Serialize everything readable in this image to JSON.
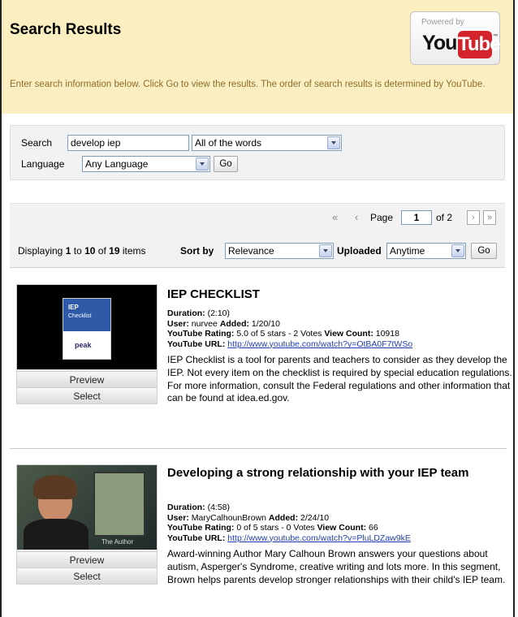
{
  "header": {
    "title": "Search Results",
    "intro": "Enter search information below. Click Go to view the results. The order of search results is determined by YouTube.",
    "badge": {
      "powered_by": "Powered by",
      "you": "You",
      "tube": "Tube",
      "tm": "™"
    }
  },
  "search": {
    "search_label": "Search",
    "query": "develop iep",
    "match_mode": "All of the words",
    "language_label": "Language",
    "language": "Any Language",
    "go_label": "Go"
  },
  "pager": {
    "first_glyph": "«",
    "prev_glyph": "‹",
    "next_glyph": "›",
    "last_glyph": "»",
    "page_label": "Page",
    "page_value": "1",
    "of_label": "of 2"
  },
  "list": {
    "displaying_label": "Displaying",
    "from": "1",
    "to_label": "to",
    "to": "10",
    "of_label": "of",
    "total": "19",
    "items_label": "items",
    "sort_label": "Sort by",
    "sort_value": "Relevance",
    "uploaded_label": "Uploaded",
    "uploaded_value": "Anytime",
    "go_label": "Go"
  },
  "labels": {
    "duration": "Duration:",
    "user": "User:",
    "added": "Added:",
    "rating": "YouTube Rating:",
    "views": "View Count:",
    "url": "YouTube URL:",
    "preview": "Preview",
    "select": "Select"
  },
  "results": [
    {
      "title": "IEP CHECKLIST",
      "duration": "(2:10)",
      "user": "nurvee",
      "added": "1/20/10",
      "rating": "5.0 of 5 stars - 2 Votes",
      "views": "10918",
      "url": "http://www.youtube.com/watch?v=OtBA0F7tWSo",
      "description": "IEP Checklist is a tool for parents and teachers to consider as they develop the IEP. Not every item on the checklist is required by special education regulations. For more information, consult the Federal regulations and other information that can be found at idea.ed.gov.",
      "thumb_text": {
        "line1": "IEP",
        "line2": "Checklist",
        "brand": "peak"
      }
    },
    {
      "title": "Developing a strong relationship with your IEP team",
      "duration": "(4:58)",
      "user": "MaryCalhounBrown",
      "added": "2/24/10",
      "rating": "0 of 5 stars - 0 Votes",
      "views": "66",
      "url": "http://www.youtube.com/watch?v=PluLDZaw9kE",
      "description": "Award-winning Author Mary Calhoun Brown answers your questions about autism, Asperger's Syndrome, creative writing and lots more. In this segment, Brown helps parents develop stronger relationships with their child's IEP team.",
      "thumb_text": {
        "caption": "The Author"
      }
    }
  ]
}
